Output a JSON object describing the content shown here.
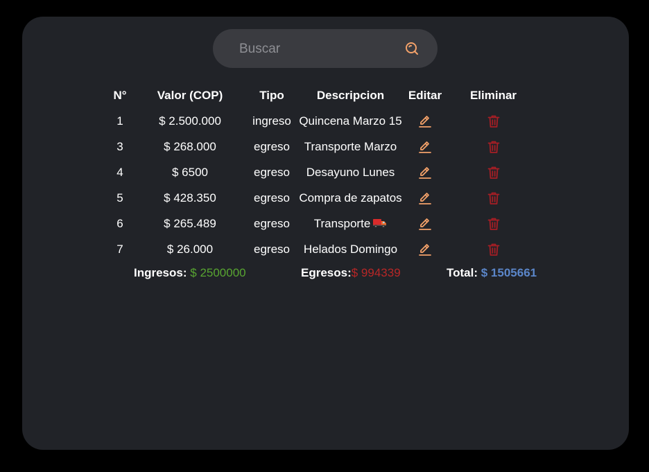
{
  "search": {
    "placeholder": "Buscar",
    "value": ""
  },
  "table": {
    "headers": [
      "N°",
      "Valor (COP)",
      "Tipo",
      "Descripcion",
      "Editar",
      "Eliminar"
    ],
    "rows": [
      {
        "num": "1",
        "valor": "$ 2.500.000",
        "tipo": "ingreso",
        "descripcion": "Quincena Marzo 15"
      },
      {
        "num": "3",
        "valor": "$ 268.000",
        "tipo": "egreso",
        "descripcion": "Transporte Marzo"
      },
      {
        "num": "4",
        "valor": "$ 6500",
        "tipo": "egreso",
        "descripcion": "Desayuno Lunes"
      },
      {
        "num": "5",
        "valor": "$ 428.350",
        "tipo": "egreso",
        "descripcion": "Compra de zapatos"
      },
      {
        "num": "6",
        "valor": "$ 265.489",
        "tipo": "egreso",
        "descripcion": "Transporte"
      },
      {
        "num": "7",
        "valor": "$ 26.000",
        "tipo": "egreso",
        "descripcion": "Helados Domingo"
      }
    ]
  },
  "totals": {
    "ingresos_label": "Ingresos:",
    "ingresos_value": "$ 2500000",
    "egresos_label": "Egresos:",
    "egresos_value": "$ 994339",
    "total_label": "Total:",
    "total_value": "$ 1505661"
  },
  "icons": {
    "search": "search-icon",
    "edit": "pencil-icon",
    "delete": "trash-icon",
    "truck": "truck-emoji"
  },
  "colors": {
    "background": "#000000",
    "panel": "#212328",
    "search_bg": "#3a3b40",
    "accent_orange": "#f4a26a",
    "delete_red": "#a61e25",
    "ingresos_green": "#58a531",
    "egresos_red": "#b82727",
    "total_blue": "#5b86c9"
  }
}
